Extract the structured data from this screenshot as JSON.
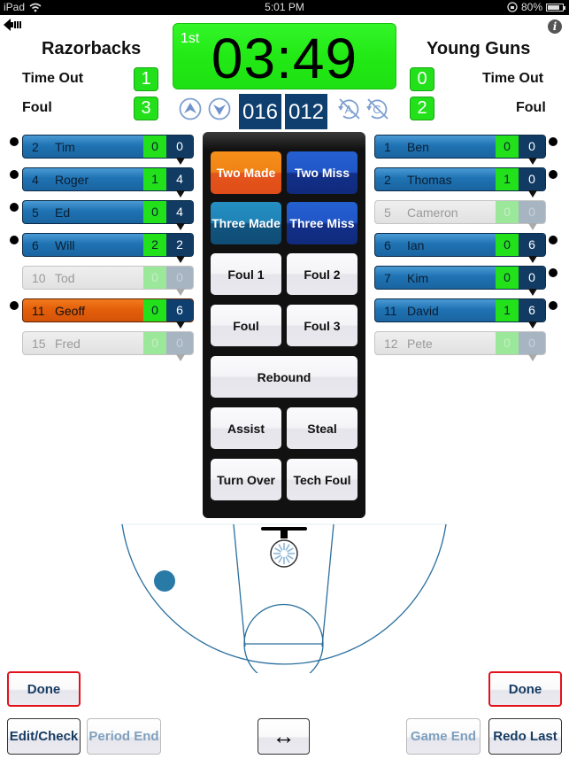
{
  "status_bar": {
    "device": "iPad",
    "time": "5:01 PM",
    "battery": "80%",
    "battery_level": 0.8
  },
  "home_team": {
    "name": "Razorbacks",
    "time_out_label": "Time Out",
    "time_out": "1",
    "foul_label": "Foul",
    "foul": "3",
    "score": "016",
    "players": [
      {
        "number": "2",
        "name": "Tim",
        "points": "0",
        "fouls": "0",
        "state": "active",
        "on_court": true
      },
      {
        "number": "4",
        "name": "Roger",
        "points": "1",
        "fouls": "4",
        "state": "active",
        "on_court": true
      },
      {
        "number": "5",
        "name": "Ed",
        "points": "0",
        "fouls": "4",
        "state": "active",
        "on_court": true
      },
      {
        "number": "6",
        "name": "Will",
        "points": "2",
        "fouls": "2",
        "state": "active",
        "on_court": true
      },
      {
        "number": "10",
        "name": "Tod",
        "points": "0",
        "fouls": "0",
        "state": "inactive",
        "on_court": false
      },
      {
        "number": "11",
        "name": "Geoff",
        "points": "0",
        "fouls": "6",
        "state": "selected",
        "on_court": true
      },
      {
        "number": "15",
        "name": "Fred",
        "points": "0",
        "fouls": "0",
        "state": "inactive",
        "on_court": false
      }
    ]
  },
  "away_team": {
    "name": "Young Guns",
    "time_out_label": "Time Out",
    "time_out": "0",
    "foul_label": "Foul",
    "foul": "2",
    "score": "012",
    "players": [
      {
        "number": "1",
        "name": "Ben",
        "points": "0",
        "fouls": "0",
        "state": "active",
        "on_court": true
      },
      {
        "number": "2",
        "name": "Thomas",
        "points": "1",
        "fouls": "0",
        "state": "active",
        "on_court": true
      },
      {
        "number": "5",
        "name": "Cameron",
        "points": "0",
        "fouls": "0",
        "state": "inactive",
        "on_court": false
      },
      {
        "number": "6",
        "name": "Ian",
        "points": "0",
        "fouls": "6",
        "state": "active",
        "on_court": true
      },
      {
        "number": "7",
        "name": "Kim",
        "points": "0",
        "fouls": "0",
        "state": "active",
        "on_court": true
      },
      {
        "number": "11",
        "name": "David",
        "points": "1",
        "fouls": "6",
        "state": "active",
        "on_court": true
      },
      {
        "number": "12",
        "name": "Pete",
        "points": "0",
        "fouls": "0",
        "state": "inactive",
        "on_court": false
      }
    ]
  },
  "clock": {
    "period": "1st",
    "time": "03:49"
  },
  "icons": {
    "back": "back-arrow-icon",
    "info": "i",
    "increase": "arrow-up-circle-icon",
    "decrease": "arrow-down-circle-icon",
    "auto_off": "auto-disabled-icon",
    "clock_off": "clock-disabled-icon",
    "swap": "↔"
  },
  "actions": {
    "two_made": "Two Made",
    "two_miss": "Two Miss",
    "three_made": "Three Made",
    "three_miss": "Three Miss",
    "foul_1": "Foul 1",
    "foul_2": "Foul 2",
    "foul": "Foul",
    "foul_3": "Foul 3",
    "rebound": "Rebound",
    "assist": "Assist",
    "steal": "Steal",
    "turn_over": "Turn Over",
    "tech_foul": "Tech Foul"
  },
  "bottom": {
    "done_left": "Done",
    "done_right": "Done",
    "edit_check": "Edit/Check",
    "period_end": "Period End",
    "swap": "↔",
    "game_end": "Game End",
    "redo_last": "Redo Last"
  },
  "colors": {
    "clock_green": "#22ea15",
    "score_navy": "#0f3f6e",
    "player_blue": "#1f73b3",
    "selected_orange": "#e35f0a",
    "done_border": "#e3111c",
    "court_line": "#2a6f9e"
  }
}
